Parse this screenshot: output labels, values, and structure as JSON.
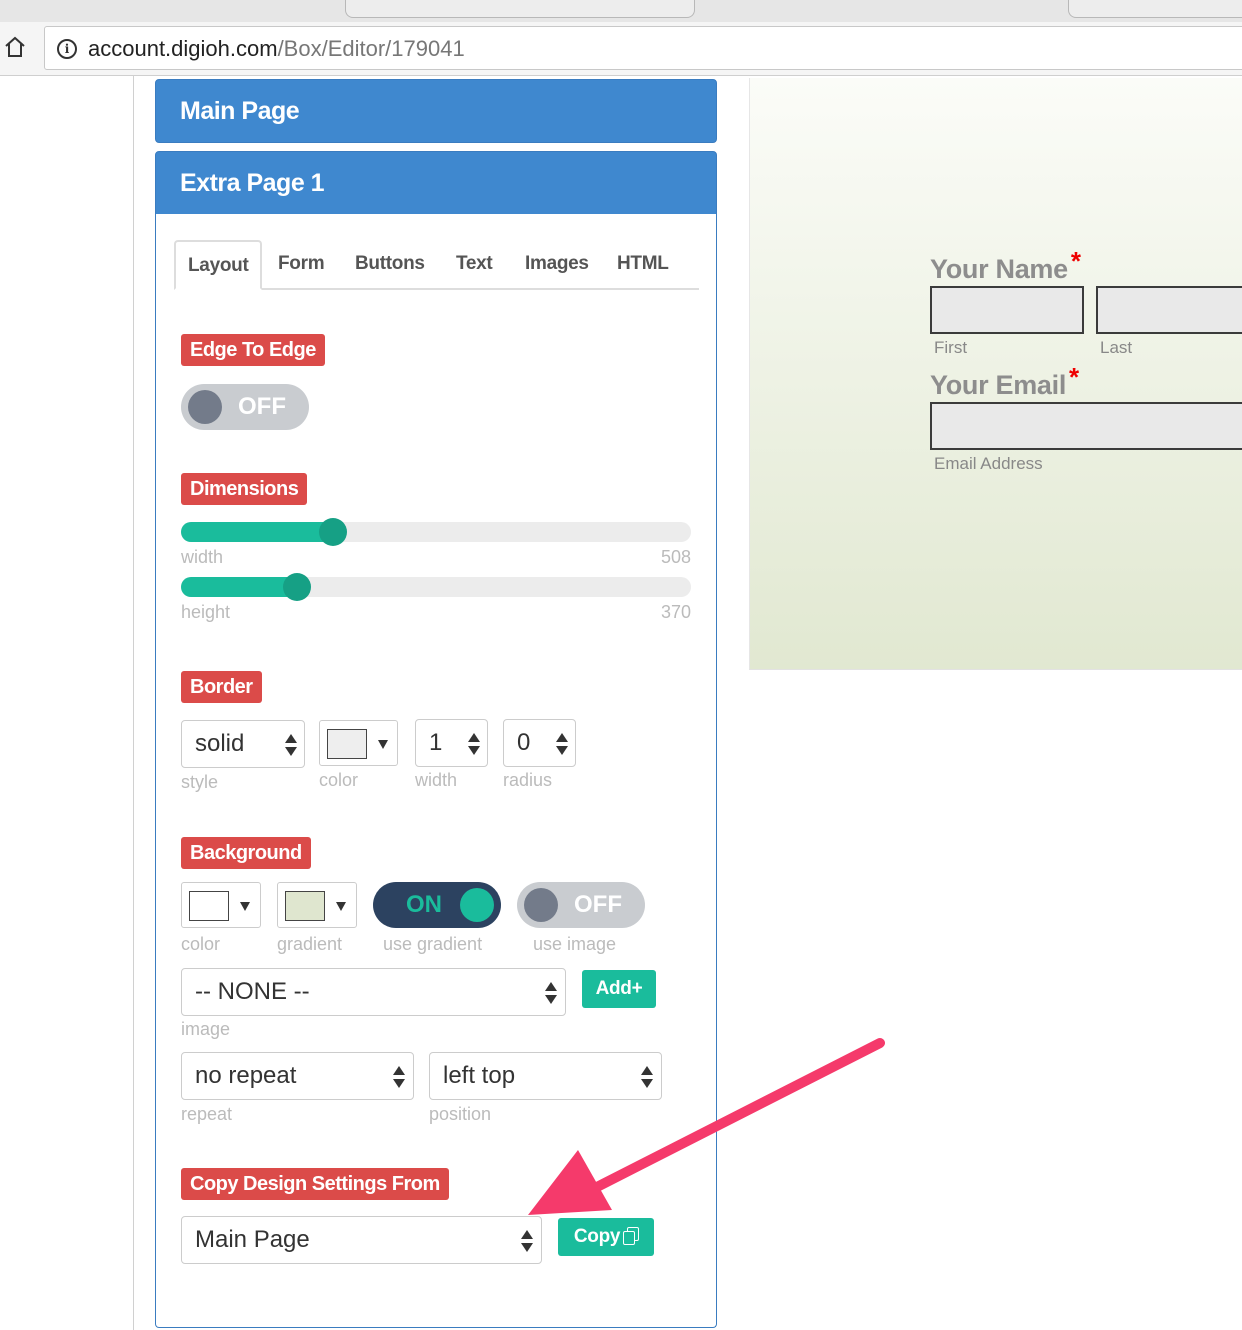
{
  "browser": {
    "url_domain": "account.digioh.com",
    "url_path": "/Box/Editor/179041"
  },
  "panels": {
    "main_page_title": "Main Page",
    "extra_page_title": "Extra Page 1"
  },
  "tabs": [
    "Layout",
    "Form",
    "Buttons",
    "Text",
    "Images",
    "HTML"
  ],
  "edge_to_edge": {
    "label": "Edge To Edge",
    "toggle": "OFF"
  },
  "dimensions": {
    "label": "Dimensions",
    "width_label": "width",
    "width_value": "508",
    "width_fraction": 0.27,
    "height_label": "height",
    "height_value": "370",
    "height_fraction": 0.2
  },
  "border": {
    "label": "Border",
    "style": "solid",
    "style_caption": "style",
    "color_caption": "color",
    "color": "#eeeeee",
    "width": "1",
    "width_caption": "width",
    "radius": "0",
    "radius_caption": "radius"
  },
  "background": {
    "label": "Background",
    "color_caption": "color",
    "color": "#ffffff",
    "gradient_caption": "gradient",
    "gradient": "#dfe6cf",
    "use_gradient_toggle": "ON",
    "use_gradient_caption": "use gradient",
    "use_image_toggle": "OFF",
    "use_image_caption": "use image",
    "image": "-- NONE --",
    "image_caption": "image",
    "add_button": "Add+",
    "repeat": "no repeat",
    "repeat_caption": "repeat",
    "position": "left top",
    "position_caption": "position"
  },
  "copy_design": {
    "label": "Copy Design Settings From",
    "source": "Main Page",
    "copy_button": "Copy"
  },
  "preview": {
    "name_label": "Your Name",
    "first_caption": "First",
    "last_caption": "Last",
    "email_label": "Your Email",
    "email_caption": "Email Address",
    "required_mark": "*"
  },
  "colors": {
    "header_blue": "#3f88cf",
    "badge_red": "#db4b49",
    "accent_green": "#1abc9c",
    "annotation_arrow": "#f53a6b"
  }
}
